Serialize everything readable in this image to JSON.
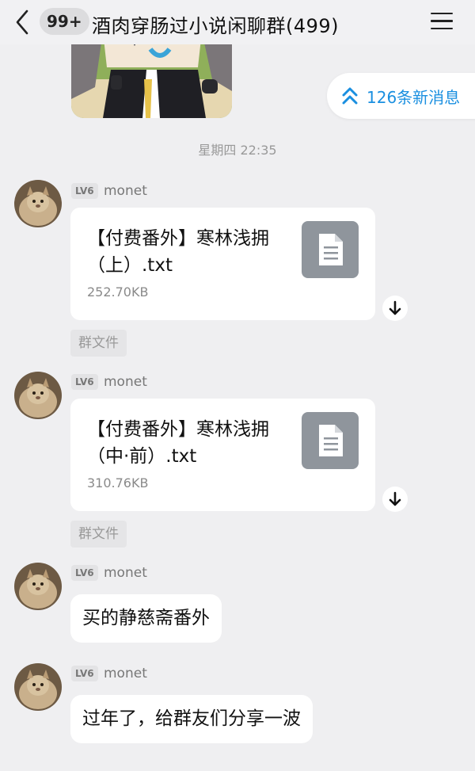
{
  "header": {
    "unread_count": "99+",
    "title": "酒肉穿肠过小说闲聊群(499)",
    "back_icon": "chevron-left-icon",
    "menu_icon": "hamburger-menu-icon"
  },
  "new_messages": {
    "label": "126条新消息",
    "icon": "double-chevron-up-icon",
    "color": "#1a8fe0"
  },
  "dividers": {
    "first": "星期四 22:35"
  },
  "messages": [
    {
      "level": "LV6",
      "sender": "monet",
      "type": "file",
      "file_name": "【付费番外】寒林浅拥（上）.txt",
      "file_size": "252.70KB",
      "tag": "群文件"
    },
    {
      "level": "LV6",
      "sender": "monet",
      "type": "file",
      "file_name": "【付费番外】寒林浅拥（中·前）.txt",
      "file_size": "310.76KB",
      "tag": "群文件"
    },
    {
      "level": "LV6",
      "sender": "monet",
      "type": "text",
      "text": "买的静慈斋番外"
    },
    {
      "level": "LV6",
      "sender": "monet",
      "type": "text",
      "text": "过年了，给群友们分享一波"
    }
  ],
  "colors": {
    "background": "#efeff1",
    "accent": "#1a8fe0",
    "file_icon": "#8f959c"
  }
}
